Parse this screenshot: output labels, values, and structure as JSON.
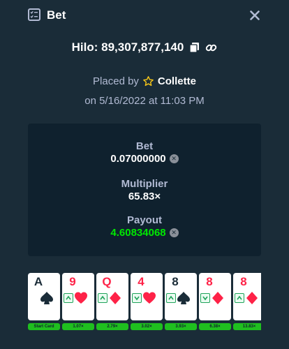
{
  "header": {
    "title": "Bet",
    "icon": "bet-slip-icon",
    "close_icon": "close-icon"
  },
  "bet": {
    "id_text": "Hilo: 89,307,877,140",
    "placed_prefix": "Placed by",
    "user": "Collette",
    "date_text": "on 5/16/2022 at 11:03 PM"
  },
  "stats": {
    "bet_label": "Bet",
    "bet_value": "0.07000000",
    "multiplier_label": "Multiplier",
    "multiplier_value": "65.83×",
    "payout_label": "Payout",
    "payout_value": "4.60834068"
  },
  "colors": {
    "background": "#1a2c38",
    "panel": "#0f212e",
    "muted_text": "#b1bad3",
    "win_green": "#00e701",
    "card_red": "#fe2247"
  },
  "cards": [
    {
      "rank": "A",
      "suit": "spade",
      "color": "black",
      "guess": "",
      "mult": "Start Card"
    },
    {
      "rank": "9",
      "suit": "heart",
      "color": "red",
      "guess": "up",
      "mult": "1.07×"
    },
    {
      "rank": "Q",
      "suit": "diamond",
      "color": "red",
      "guess": "up",
      "mult": "2.79×"
    },
    {
      "rank": "4",
      "suit": "heart",
      "color": "red",
      "guess": "down",
      "mult": "3.02×"
    },
    {
      "rank": "8",
      "suit": "spade",
      "color": "black",
      "guess": "up",
      "mult": "3.93×"
    },
    {
      "rank": "8",
      "suit": "diamond",
      "color": "red",
      "guess": "down",
      "mult": "6.38×"
    },
    {
      "rank": "8",
      "suit": "diamond",
      "color": "red",
      "guess": "up",
      "mult": "13.83×"
    },
    {
      "rank": "",
      "suit": "",
      "color": "black",
      "guess": "",
      "mult": ""
    }
  ]
}
